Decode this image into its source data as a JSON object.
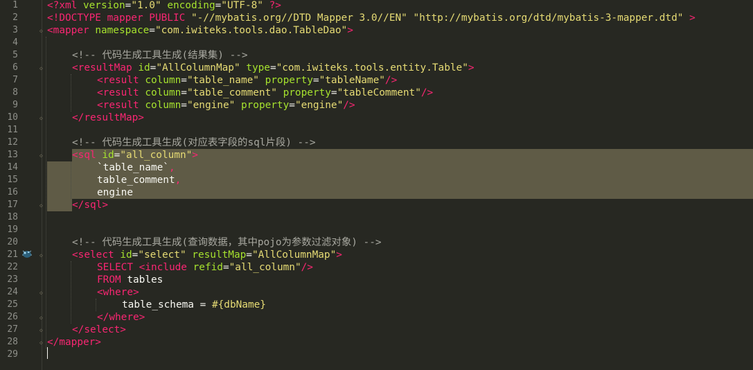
{
  "editor": {
    "language": "xml",
    "line_numbers": [
      "1",
      "2",
      "3",
      "4",
      "5",
      "6",
      "7",
      "8",
      "9",
      "10",
      "11",
      "12",
      "13",
      "14",
      "15",
      "16",
      "17",
      "18",
      "19",
      "20",
      "21",
      "22",
      "23",
      "24",
      "25",
      "26",
      "27",
      "28",
      "29"
    ],
    "lines": [
      {
        "n": 1,
        "indent": 0,
        "tokens": [
          {
            "c": "t",
            "v": "<?xml "
          },
          {
            "c": "a",
            "v": "version"
          },
          {
            "c": "p",
            "v": "="
          },
          {
            "c": "s",
            "v": "\"1.0\""
          },
          {
            "c": "p",
            "v": " "
          },
          {
            "c": "a",
            "v": "encoding"
          },
          {
            "c": "p",
            "v": "="
          },
          {
            "c": "s",
            "v": "\"UTF-8\""
          },
          {
            "c": "p",
            "v": " "
          },
          {
            "c": "t",
            "v": "?>"
          }
        ]
      },
      {
        "n": 2,
        "indent": 0,
        "tokens": [
          {
            "c": "t",
            "v": "<!DOCTYPE mapper PUBLIC "
          },
          {
            "c": "s",
            "v": "\"-//mybatis.org//DTD Mapper 3.0//EN\""
          },
          {
            "c": "p",
            "v": " "
          },
          {
            "c": "s",
            "v": "\"http://mybatis.org/dtd/mybatis-3-mapper.dtd\""
          },
          {
            "c": "p",
            "v": " "
          },
          {
            "c": "t",
            "v": ">"
          }
        ]
      },
      {
        "n": 3,
        "indent": 0,
        "tokens": [
          {
            "c": "t",
            "v": "<mapper "
          },
          {
            "c": "a",
            "v": "namespace"
          },
          {
            "c": "p",
            "v": "="
          },
          {
            "c": "s",
            "v": "\"com.iwiteks.tools.dao.TableDao\""
          },
          {
            "c": "t",
            "v": ">"
          }
        ]
      },
      {
        "n": 4,
        "indent": 0,
        "tokens": []
      },
      {
        "n": 5,
        "indent": 1,
        "tokens": [
          {
            "c": "c",
            "v": "<!-- 代码生成工具生成(结果集) -->"
          }
        ]
      },
      {
        "n": 6,
        "indent": 1,
        "tokens": [
          {
            "c": "t",
            "v": "<resultMap "
          },
          {
            "c": "a",
            "v": "id"
          },
          {
            "c": "p",
            "v": "="
          },
          {
            "c": "s",
            "v": "\"AllColumnMap\""
          },
          {
            "c": "p",
            "v": " "
          },
          {
            "c": "a",
            "v": "type"
          },
          {
            "c": "p",
            "v": "="
          },
          {
            "c": "s",
            "v": "\"com.iwiteks.tools.entity.Table\""
          },
          {
            "c": "t",
            "v": ">"
          }
        ]
      },
      {
        "n": 7,
        "indent": 2,
        "tokens": [
          {
            "c": "t",
            "v": "<result "
          },
          {
            "c": "a",
            "v": "column"
          },
          {
            "c": "p",
            "v": "="
          },
          {
            "c": "s",
            "v": "\"table_name\""
          },
          {
            "c": "p",
            "v": " "
          },
          {
            "c": "a",
            "v": "property"
          },
          {
            "c": "p",
            "v": "="
          },
          {
            "c": "s",
            "v": "\"tableName\""
          },
          {
            "c": "t",
            "v": "/>"
          }
        ]
      },
      {
        "n": 8,
        "indent": 2,
        "tokens": [
          {
            "c": "t",
            "v": "<result "
          },
          {
            "c": "a",
            "v": "column"
          },
          {
            "c": "p",
            "v": "="
          },
          {
            "c": "s",
            "v": "\"table_comment\""
          },
          {
            "c": "p",
            "v": " "
          },
          {
            "c": "a",
            "v": "property"
          },
          {
            "c": "p",
            "v": "="
          },
          {
            "c": "s",
            "v": "\"tableComment\""
          },
          {
            "c": "t",
            "v": "/>"
          }
        ]
      },
      {
        "n": 9,
        "indent": 2,
        "tokens": [
          {
            "c": "t",
            "v": "<result "
          },
          {
            "c": "a",
            "v": "column"
          },
          {
            "c": "p",
            "v": "="
          },
          {
            "c": "s",
            "v": "\"engine\""
          },
          {
            "c": "p",
            "v": " "
          },
          {
            "c": "a",
            "v": "property"
          },
          {
            "c": "p",
            "v": "="
          },
          {
            "c": "s",
            "v": "\"engine\""
          },
          {
            "c": "t",
            "v": "/>"
          }
        ]
      },
      {
        "n": 10,
        "indent": 1,
        "tokens": [
          {
            "c": "t",
            "v": "</resultMap>"
          }
        ]
      },
      {
        "n": 11,
        "indent": 0,
        "tokens": []
      },
      {
        "n": 12,
        "indent": 1,
        "tokens": [
          {
            "c": "c",
            "v": "<!-- 代码生成工具生成(对应表字段的sql片段) -->"
          }
        ]
      },
      {
        "n": 13,
        "indent": 1,
        "tokens": [
          {
            "c": "t",
            "v": "<sql "
          },
          {
            "c": "a",
            "v": "id"
          },
          {
            "c": "p",
            "v": "="
          },
          {
            "c": "s",
            "v": "\"all_column\""
          },
          {
            "c": "t",
            "v": ">"
          }
        ]
      },
      {
        "n": 14,
        "indent": 2,
        "tokens": [
          {
            "c": "p",
            "v": "`table_name`"
          },
          {
            "c": "t",
            "v": ","
          }
        ]
      },
      {
        "n": 15,
        "indent": 2,
        "tokens": [
          {
            "c": "p",
            "v": "table_comment"
          },
          {
            "c": "t",
            "v": ","
          }
        ]
      },
      {
        "n": 16,
        "indent": 2,
        "tokens": [
          {
            "c": "p",
            "v": "engine"
          }
        ]
      },
      {
        "n": 17,
        "indent": 1,
        "tokens": [
          {
            "c": "t",
            "v": "</sql>"
          }
        ]
      },
      {
        "n": 18,
        "indent": 0,
        "tokens": []
      },
      {
        "n": 19,
        "indent": 0,
        "tokens": []
      },
      {
        "n": 20,
        "indent": 1,
        "tokens": [
          {
            "c": "c",
            "v": "<!-- 代码生成工具生成(查询数据，其中pojo为参数过滤对象) -->"
          }
        ]
      },
      {
        "n": 21,
        "indent": 1,
        "tokens": [
          {
            "c": "t",
            "v": "<select "
          },
          {
            "c": "a",
            "v": "id"
          },
          {
            "c": "p",
            "v": "="
          },
          {
            "c": "s",
            "v": "\"select\""
          },
          {
            "c": "p",
            "v": " "
          },
          {
            "c": "a",
            "v": "resultMap"
          },
          {
            "c": "p",
            "v": "="
          },
          {
            "c": "s",
            "v": "\"AllColumnMap\""
          },
          {
            "c": "t",
            "v": ">"
          }
        ]
      },
      {
        "n": 22,
        "indent": 2,
        "tokens": [
          {
            "c": "k",
            "v": "SELECT "
          },
          {
            "c": "t",
            "v": "<include "
          },
          {
            "c": "a",
            "v": "refid"
          },
          {
            "c": "p",
            "v": "="
          },
          {
            "c": "s",
            "v": "\"all_column\""
          },
          {
            "c": "t",
            "v": "/>"
          }
        ]
      },
      {
        "n": 23,
        "indent": 2,
        "tokens": [
          {
            "c": "k",
            "v": "FROM "
          },
          {
            "c": "p",
            "v": "tables"
          }
        ]
      },
      {
        "n": 24,
        "indent": 2,
        "tokens": [
          {
            "c": "t",
            "v": "<where>"
          }
        ]
      },
      {
        "n": 25,
        "indent": 3,
        "tokens": [
          {
            "c": "p",
            "v": "table_schema = "
          },
          {
            "c": "s",
            "v": "#{dbName}"
          }
        ]
      },
      {
        "n": 26,
        "indent": 2,
        "tokens": [
          {
            "c": "t",
            "v": "</where>"
          }
        ]
      },
      {
        "n": 27,
        "indent": 1,
        "tokens": [
          {
            "c": "t",
            "v": "</select>"
          }
        ]
      },
      {
        "n": 28,
        "indent": 0,
        "tokens": [
          {
            "c": "t",
            "v": "</mapper>"
          }
        ]
      },
      {
        "n": 29,
        "indent": 0,
        "tokens": []
      }
    ],
    "selection": {
      "from_line": 13,
      "to_line": 17
    },
    "caret_line": 29,
    "fold_markers_lines": [
      3,
      6,
      10,
      13,
      17,
      21,
      24,
      26,
      27,
      28
    ],
    "breakpoint_icon_line": 21,
    "colors": {
      "background": "#272822",
      "tag": "#f92672",
      "attribute": "#a6e22e",
      "string": "#e6db74",
      "comment": "#a8a8a0",
      "text": "#f8f8f2",
      "selection": "#5f5b46",
      "line_number": "#8f908a"
    }
  }
}
